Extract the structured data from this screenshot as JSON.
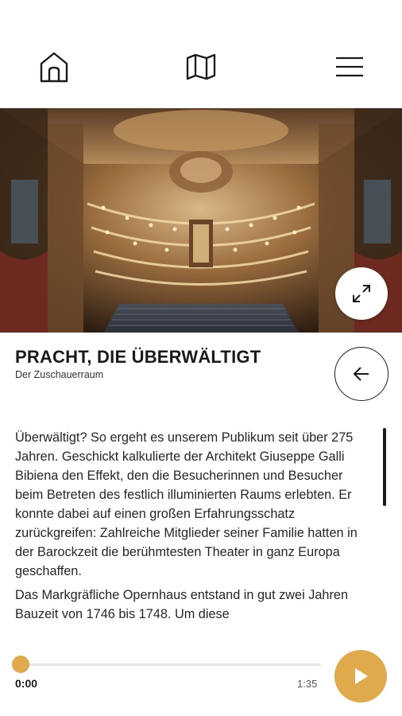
{
  "nav": {
    "home_icon": "home-icon",
    "map_icon": "map-icon",
    "menu_icon": "hamburger-menu-icon"
  },
  "hero": {
    "image": "baroque opera house auditorium",
    "expand_icon": "expand-icon"
  },
  "header": {
    "title": "PRACHT, DIE ÜBERWÄLTIGT",
    "subtitle": "Der Zuschauerraum",
    "back_icon": "arrow-left-icon"
  },
  "content": {
    "paragraphs": [
      "Überwältigt? So ergeht es unserem Publikum seit über 275 Jahren. Geschickt kalkulierte der Architekt Giuseppe Galli Bibiena den Effekt, den die Besucherinnen und Besucher beim Betreten des festlich illuminierten Raums erlebten. Er konnte dabei auf einen großen Erfahrungsschatz zurückgreifen: Zahlreiche Mitglieder seiner Familie hatten in der Barockzeit die berühmtesten Theater in ganz Europa geschaffen.",
      "Das Markgräfliche Opernhaus entstand in gut zwei Jahren Bauzeit von 1746 bis 1748. Um diese"
    ]
  },
  "player": {
    "current_time": "0:00",
    "total_time": "1:35",
    "progress": 0,
    "play_icon": "play-icon"
  },
  "colors": {
    "accent": "#dfa94c",
    "text": "#1a1a1a"
  }
}
